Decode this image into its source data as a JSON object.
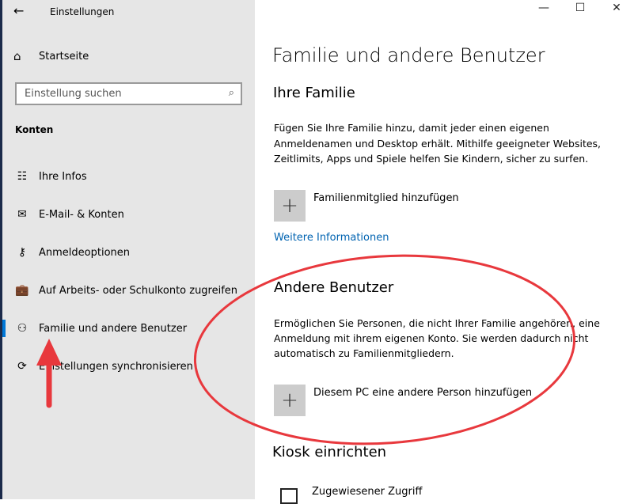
{
  "window": {
    "title": "Einstellungen",
    "back_icon": "arrow-left",
    "minimize": "—",
    "maximize": "☐",
    "close": "✕"
  },
  "sidebar": {
    "home": "Startseite",
    "search_placeholder": "Einstellung suchen",
    "section": "Konten",
    "items": [
      {
        "label": "Ihre Infos",
        "icon": "☷"
      },
      {
        "label": "E-Mail- & Konten",
        "icon": "✉"
      },
      {
        "label": "Anmeldeoptionen",
        "icon": "⚷"
      },
      {
        "label": "Auf Arbeits- oder Schulkonto zugreifen",
        "icon": "💼"
      },
      {
        "label": "Familie und andere Benutzer",
        "icon": "⚇"
      },
      {
        "label": "Einstellungen synchronisieren",
        "icon": "⟳"
      }
    ]
  },
  "main": {
    "title": "Familie und andere Benutzer",
    "family": {
      "heading": "Ihre Familie",
      "text": "Fügen Sie Ihre Familie hinzu, damit jeder einen eigenen Anmeldenamen und Desktop erhält. Mithilfe geeigneter Websites, Zeitlimits, Apps und Spiele helfen Sie Kindern, sicher zu surfen.",
      "add": "Familienmitglied hinzufügen",
      "link": "Weitere Informationen"
    },
    "others": {
      "heading": "Andere Benutzer",
      "text": "Ermöglichen Sie Personen, die nicht Ihrer Familie angehören, eine Anmeldung mit ihrem eigenen Konto. Sie werden dadurch nicht automatisch zu Familienmitgliedern.",
      "add": "Diesem PC eine andere Person hinzufügen"
    },
    "kiosk": {
      "heading": "Kiosk einrichten",
      "item": "Zugewiesener Zugriff"
    }
  },
  "colors": {
    "accent": "#0078d7",
    "annotation": "#e8383d",
    "link": "#0063b1"
  }
}
